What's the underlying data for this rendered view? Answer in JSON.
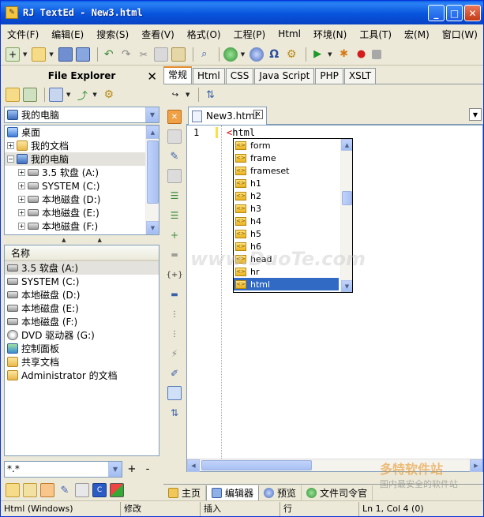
{
  "window": {
    "title": "RJ TextEd - New3.html"
  },
  "title_buttons": {
    "minimize": "_",
    "maximize": "□",
    "close": "✕"
  },
  "menu": [
    "文件(F)",
    "编辑(E)",
    "搜索(S)",
    "查看(V)",
    "格式(O)",
    "工程(P)",
    "Html",
    "环境(N)",
    "工具(T)",
    "宏(M)",
    "窗口(W)"
  ],
  "file_explorer": {
    "title": "File Explorer",
    "location": "我的电脑",
    "tree": [
      {
        "label": "桌面",
        "icon": "desktop-icon",
        "expander": ""
      },
      {
        "label": "我的文档",
        "icon": "folder-icon",
        "expander": "+"
      },
      {
        "label": "我的电脑",
        "icon": "computer-icon",
        "expander": "−"
      },
      {
        "label": "3.5 软盘 (A:)",
        "icon": "floppy-icon",
        "expander": "+"
      },
      {
        "label": "SYSTEM (C:)",
        "icon": "drive-icon",
        "expander": "+"
      },
      {
        "label": "本地磁盘 (D:)",
        "icon": "drive-icon",
        "expander": "+"
      },
      {
        "label": "本地磁盘 (E:)",
        "icon": "drive-icon",
        "expander": "+"
      },
      {
        "label": "本地磁盘 (F:)",
        "icon": "drive-icon",
        "expander": "+"
      }
    ],
    "list_header": "名称",
    "list": [
      {
        "label": "3.5 软盘 (A:)",
        "icon": "floppy-icon"
      },
      {
        "label": "SYSTEM (C:)",
        "icon": "drive-icon"
      },
      {
        "label": "本地磁盘 (D:)",
        "icon": "drive-icon"
      },
      {
        "label": "本地磁盘 (E:)",
        "icon": "drive-icon"
      },
      {
        "label": "本地磁盘 (F:)",
        "icon": "drive-icon"
      },
      {
        "label": "DVD 驱动器 (G:)",
        "icon": "dvd-icon"
      },
      {
        "label": "控制面板",
        "icon": "control-panel-icon"
      },
      {
        "label": "共享文档",
        "icon": "folder-icon"
      },
      {
        "label": "Administrator 的文档",
        "icon": "folder-icon"
      }
    ],
    "filter_value": "*.*",
    "plus_label": "+",
    "minus_label": "-"
  },
  "snippet_tabs": [
    "常规",
    "Html",
    "CSS",
    "Java Script",
    "PHP",
    "XSLT"
  ],
  "document_tab": {
    "label": "New3.html",
    "close": "x"
  },
  "editor": {
    "line_number": "1",
    "code_open": "<",
    "code_text": "html"
  },
  "autocomplete": {
    "items": [
      "form",
      "frame",
      "frameset",
      "h1",
      "h2",
      "h3",
      "h4",
      "h5",
      "h6",
      "head",
      "hr",
      "html"
    ],
    "selected": "html"
  },
  "bottom_tabs": [
    "主页",
    "编辑器",
    "预览",
    "文件司令官"
  ],
  "status": {
    "mode": "Html (Windows)",
    "modified": "修改",
    "insert": "插入",
    "line_label": "行",
    "position": "Ln 1, Col 4 (0)"
  },
  "watermark": {
    "text": "www.DuoTe.com",
    "badge": "多特软件站",
    "slogan": "国内最安全的软件站"
  },
  "colors": {
    "titlebar": "#0855dd",
    "selection": "#316ac5",
    "tag_marker": "#d40000"
  }
}
